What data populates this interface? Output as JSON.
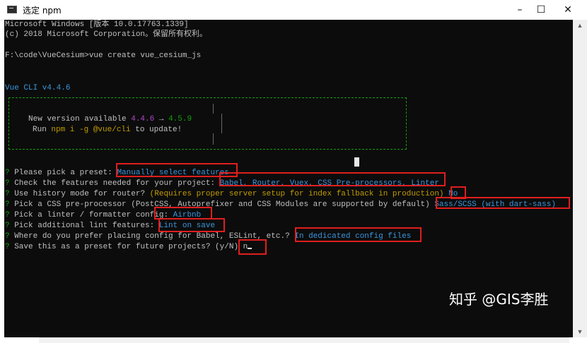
{
  "window": {
    "title": "选定 npm",
    "minimize": "–",
    "maximize": "☐",
    "close": "✕"
  },
  "terminal": {
    "header_line1": "Microsoft Windows [版本 10.0.17763.1339]",
    "header_line2": "(c) 2018 Microsoft Corporation。保留所有权利。",
    "command_line": "F:\\code\\VueCesium>vue create vue_cesium_js",
    "cli_version": "Vue CLI v4.4.6",
    "update_box": {
      "new_version_prefix": "New version available ",
      "current_version": "4.4.6",
      "arrow": " → ",
      "latest_version": "4.5.9",
      "run_prefix": "Run ",
      "run_command": "npm i -g @vue/cli",
      "run_suffix": " to update!"
    },
    "prompts": [
      {
        "mark": "?",
        "question": " Please pick a preset: ",
        "answer": "Manually select features"
      },
      {
        "mark": "?",
        "question": " Check the features needed for your project: ",
        "answer": "Babel, Router, Vuex, CSS Pre-processors, Linter"
      },
      {
        "mark": "?",
        "question": " Use history mode for router? ",
        "hint": "(Requires proper server setup for index fallback in production)",
        "answer": " No"
      },
      {
        "mark": "?",
        "question": " Pick a CSS pre-processor (PostCSS, Autoprefixer and CSS Modules are supported by default) ",
        "answer": "Sass/SCSS (with dart-sass)"
      },
      {
        "mark": "?",
        "question": " Pick a linter / formatter config: ",
        "answer": "Airbnb"
      },
      {
        "mark": "?",
        "question": " Pick additional lint features: ",
        "answer": "Lint on save"
      },
      {
        "mark": "?",
        "question": " Where do you prefer placing config for Babel, ESLint, etc.? ",
        "answer": "In dedicated config files"
      },
      {
        "mark": "?",
        "question": " Save this as a preset for future projects? (y/N) ",
        "answer": "n"
      }
    ]
  },
  "watermark": "知乎 @GIS李胜",
  "colors": {
    "terminal_bg": "#0c0c0c",
    "text": "#c0c0c0",
    "green": "#13a10e",
    "cyan": "#3a96dd",
    "magenta": "#b148c6",
    "yellow": "#c19c00",
    "annotation_red": "#e01e1e"
  }
}
